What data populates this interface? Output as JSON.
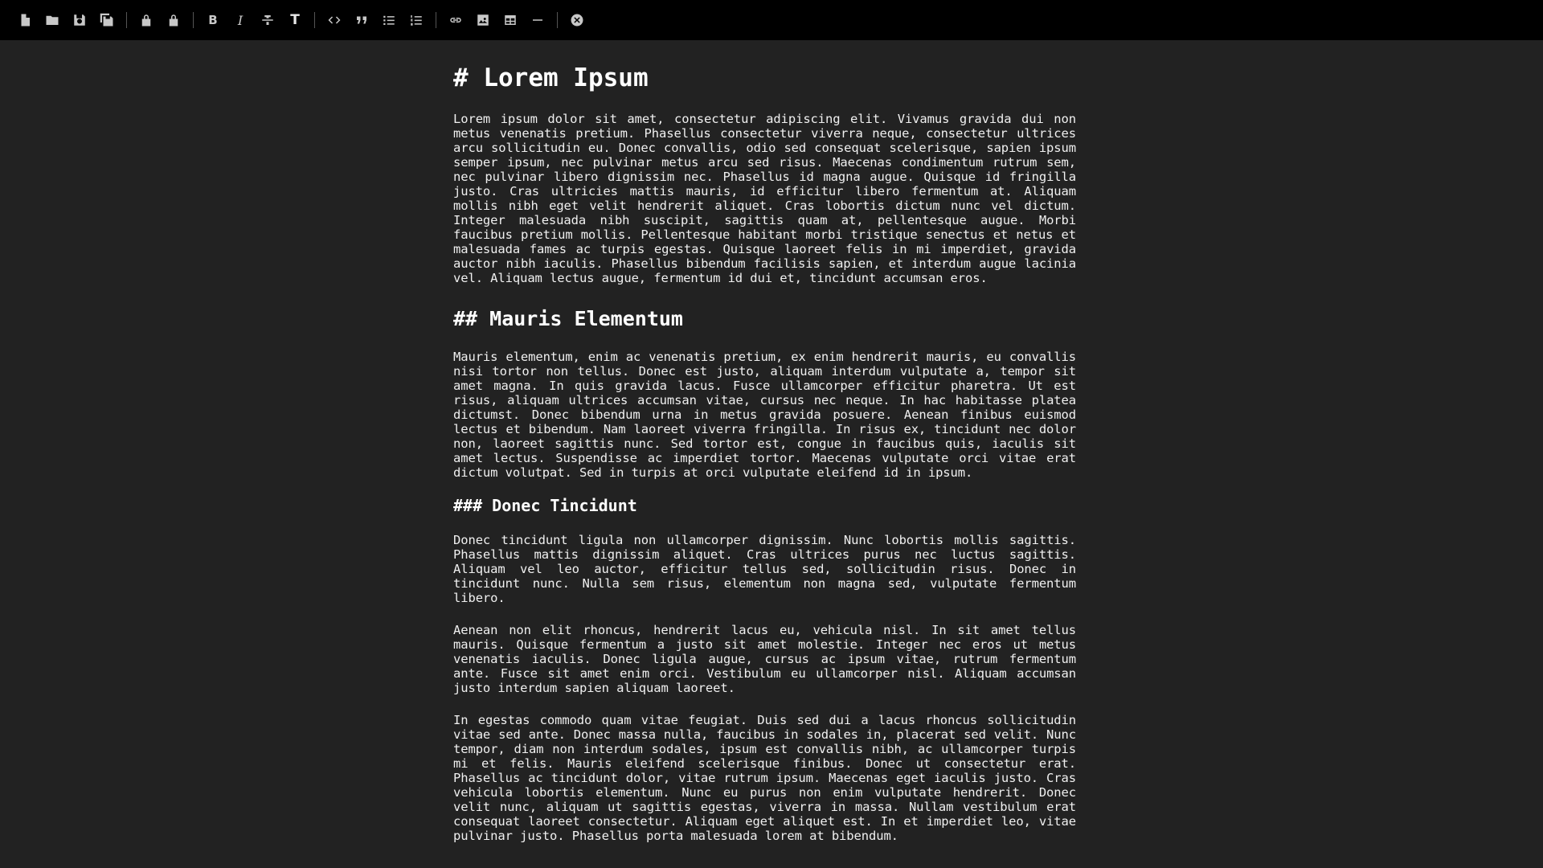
{
  "toolbar": {
    "buttons": [
      {
        "name": "new-file-icon"
      },
      {
        "name": "open-folder-icon"
      },
      {
        "name": "save-icon"
      },
      {
        "name": "save-all-icon"
      },
      {
        "name": "lock-icon"
      },
      {
        "name": "lock-alt-icon"
      },
      {
        "name": "bold-icon",
        "label": "B"
      },
      {
        "name": "italic-icon",
        "label": "I"
      },
      {
        "name": "strikethrough-icon"
      },
      {
        "name": "heading-icon",
        "label": "T"
      },
      {
        "name": "code-icon"
      },
      {
        "name": "quote-icon"
      },
      {
        "name": "bullet-list-icon"
      },
      {
        "name": "numbered-list-icon"
      },
      {
        "name": "link-icon"
      },
      {
        "name": "image-icon"
      },
      {
        "name": "table-icon"
      },
      {
        "name": "horizontal-rule-icon"
      },
      {
        "name": "close-icon"
      }
    ]
  },
  "document": {
    "h1": "# Lorem Ipsum",
    "p1": "Lorem ipsum dolor sit amet, consectetur adipiscing elit. Vivamus gravida dui non metus venenatis pretium. Phasellus consectetur viverra neque, consectetur ultrices arcu sollicitudin eu. Donec convallis, odio sed consequat scelerisque, sapien ipsum semper ipsum, nec pulvinar metus arcu sed risus. Maecenas condimentum rutrum sem, nec pulvinar libero dignissim nec. Phasellus id magna augue. Quisque id fringilla justo. Cras ultricies mattis mauris, id efficitur libero fermentum at. Aliquam mollis nibh eget velit hendrerit aliquet. Cras lobortis dictum nunc vel dictum. Integer malesuada nibh suscipit, sagittis quam at, pellentesque augue. Morbi faucibus pretium mollis. Pellentesque habitant morbi tristique senectus et netus et malesuada fames ac turpis egestas. Quisque laoreet felis in mi imperdiet, gravida auctor nibh iaculis. Phasellus bibendum facilisis sapien, et interdum augue lacinia vel. Aliquam lectus augue, fermentum id dui et, tincidunt accumsan eros.",
    "h2": "## Mauris Elementum",
    "p2": "Mauris elementum, enim ac venenatis pretium, ex enim hendrerit mauris, eu convallis nisi tortor non tellus. Donec est justo, aliquam interdum vulputate a, tempor sit amet magna. In quis gravida lacus. Fusce ullamcorper efficitur pharetra. Ut est risus, aliquam ultrices accumsan vitae, cursus nec neque. In hac habitasse platea dictumst. Donec bibendum urna in metus gravida posuere. Aenean finibus euismod lectus et bibendum. Nam laoreet viverra fringilla. In risus ex, tincidunt nec dolor non, laoreet sagittis nunc. Sed tortor est, congue in faucibus quis, iaculis sit amet lectus. Suspendisse ac imperdiet tortor. Maecenas vulputate orci vitae erat dictum volutpat. Sed in turpis at orci vulputate eleifend id in ipsum.",
    "h3": "### Donec Tincidunt",
    "p3": "Donec tincidunt ligula non ullamcorper dignissim. Nunc lobortis mollis sagittis. Phasellus mattis dignissim aliquet. Cras ultrices purus nec luctus sagittis. Aliquam vel leo auctor, efficitur tellus sed, sollicitudin risus. Donec in tincidunt nunc. Nulla sem risus, elementum non magna sed, vulputate fermentum libero.",
    "p4": "Aenean non elit rhoncus, hendrerit lacus eu, vehicula nisl. In sit amet tellus mauris. Quisque fermentum a justo sit amet molestie. Integer nec eros ut metus venenatis iaculis. Donec ligula augue, cursus ac ipsum vitae, rutrum fermentum ante. Fusce sit amet enim orci. Vestibulum eu ullamcorper nisl. Aliquam accumsan justo interdum sapien aliquam laoreet.",
    "p5": "In egestas commodo quam vitae feugiat. Duis sed dui a lacus rhoncus sollicitudin vitae sed ante. Donec massa nulla, faucibus in sodales in, placerat sed velit. Nunc tempor, diam non interdum sodales, ipsum est convallis nibh, ac ullamcorper turpis mi et felis. Mauris eleifend scelerisque finibus. Donec ut consectetur erat. Phasellus ac tincidunt dolor, vitae rutrum ipsum. Maecenas eget iaculis justo. Cras vehicula lobortis elementum. Nunc eu purus non enim vulputate hendrerit. Donec velit nunc, aliquam ut sagittis egestas, viverra in massa. Nullam vestibulum erat consequat laoreet consectetur. Aliquam eget aliquet est. In et imperdiet leo, vitae pulvinar justo. Phasellus porta malesuada lorem at bibendum."
  }
}
